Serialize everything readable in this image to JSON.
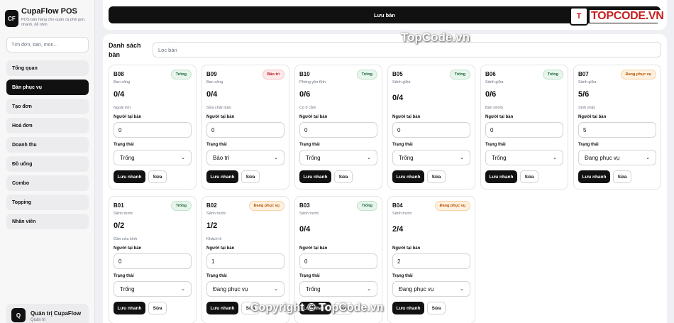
{
  "brand": {
    "logo": "CF",
    "name": "CupaFlow POS",
    "tagline": "POS bán hàng cho quán cà phê gọn, nhanh, dễ nhìn"
  },
  "sidebar": {
    "search_placeholder": "Tìm đơn, bàn, món...",
    "items": [
      {
        "label": "Tổng quan"
      },
      {
        "label": "Bàn phục vụ",
        "active": true
      },
      {
        "label": "Tạo đơn"
      },
      {
        "label": "Hoá đơn"
      },
      {
        "label": "Doanh thu"
      },
      {
        "label": "Đồ uống"
      },
      {
        "label": "Combo"
      },
      {
        "label": "Topping"
      },
      {
        "label": "Nhân viên"
      }
    ],
    "user": {
      "avatar": "Q",
      "name": "Quản trị CupaFlow",
      "role": "Quản trị"
    }
  },
  "toolbar": {
    "save_label": "Lưu bàn"
  },
  "panel": {
    "title": "Danh sách bàn",
    "filter_placeholder": "Lọc bàn"
  },
  "form_labels": {
    "guests": "Người tại bàn",
    "status": "Trạng thái",
    "quick_save": "Lưu nhanh",
    "edit": "Sửa"
  },
  "tables": [
    {
      "code": "B08",
      "area": "Ban công",
      "badge": "Trống",
      "badge_type": "empty",
      "occupancy": "0/4",
      "note": "Ngoài trời",
      "guests": "0",
      "status": "Trống"
    },
    {
      "code": "B09",
      "area": "Ban công",
      "badge": "Bảo trì",
      "badge_type": "maint",
      "occupancy": "0/4",
      "note": "Sửa chân bàn",
      "guests": "0",
      "status": "Bảo trì"
    },
    {
      "code": "B10",
      "area": "Phòng yên tĩnh",
      "badge": "Trống",
      "badge_type": "empty",
      "occupancy": "0/6",
      "note": "Có ổ cắm",
      "guests": "0",
      "status": "Trống"
    },
    {
      "code": "B05",
      "area": "Sảnh giữa",
      "badge": "Trống",
      "badge_type": "empty",
      "occupancy": "0/4",
      "note": "",
      "guests": "0",
      "status": "Trống"
    },
    {
      "code": "B06",
      "area": "Sảnh giữa",
      "badge": "Trống",
      "badge_type": "empty",
      "occupancy": "0/6",
      "note": "Bàn nhóm",
      "guests": "0",
      "status": "Trống"
    },
    {
      "code": "B07",
      "area": "Sảnh giữa",
      "badge": "Đang phục vụ",
      "badge_type": "serve",
      "occupancy": "5/6",
      "note": "Sinh nhật",
      "guests": "5",
      "status": "Đang phục vụ"
    },
    {
      "code": "B01",
      "area": "Sảnh trước",
      "badge": "Trống",
      "badge_type": "empty",
      "occupancy": "0/2",
      "note": "Gần cửa kính",
      "guests": "0",
      "status": "Trống"
    },
    {
      "code": "B02",
      "area": "Sảnh trước",
      "badge": "Đang phục vụ",
      "badge_type": "serve",
      "occupancy": "1/2",
      "note": "Khách lẻ",
      "guests": "1",
      "status": "Đang phục vụ"
    },
    {
      "code": "B03",
      "area": "Sảnh trước",
      "badge": "Trống",
      "badge_type": "empty",
      "occupancy": "0/4",
      "note": "",
      "guests": "0",
      "status": "Trống"
    },
    {
      "code": "B04",
      "area": "Sảnh trước",
      "badge": "Đang phục vụ",
      "badge_type": "serve",
      "occupancy": "2/4",
      "note": "",
      "guests": "2",
      "status": "Đang phục vụ"
    }
  ],
  "watermark": {
    "logo_mark": "T",
    "logo_text": "TOPCODE.VN",
    "top": "TopCode.vn",
    "bottom": "Copyright © TopCode.vn"
  }
}
